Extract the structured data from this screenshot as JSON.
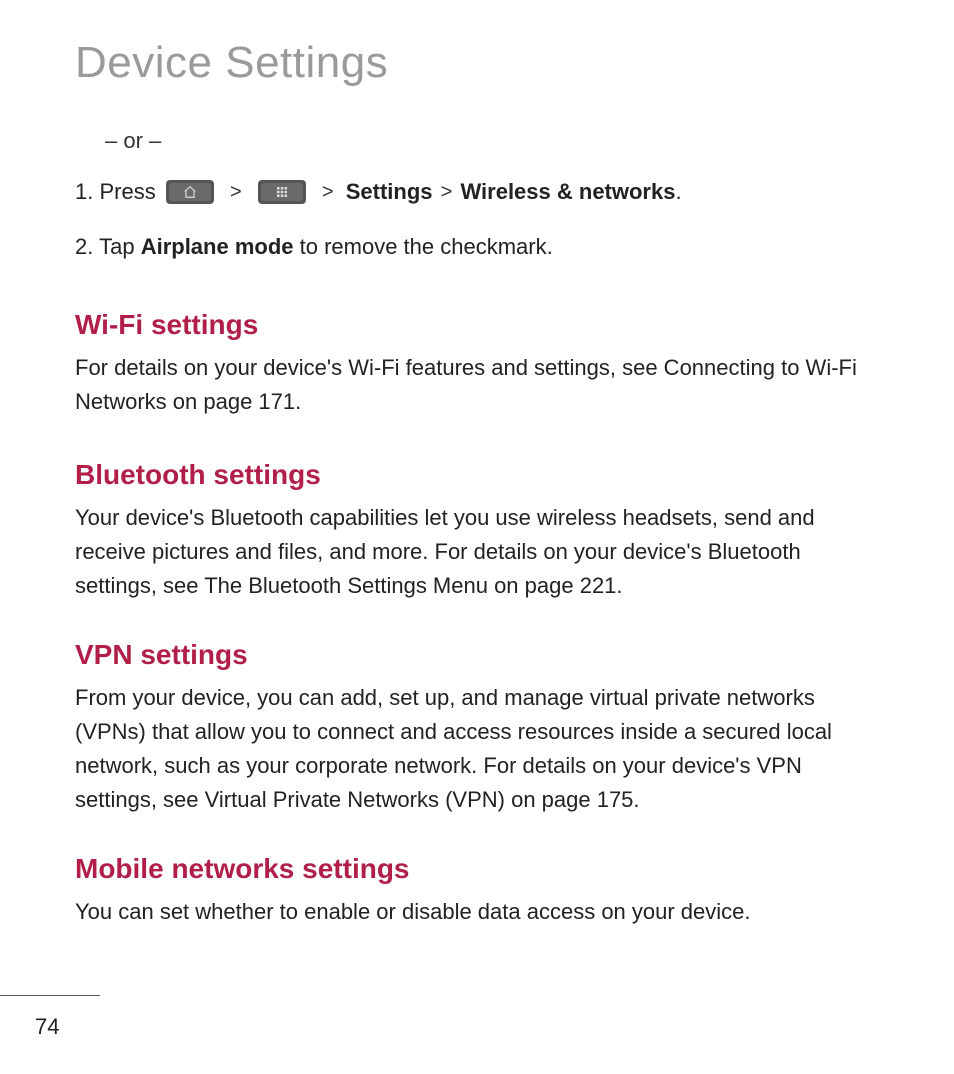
{
  "title": "Device Settings",
  "or_separator": "– or –",
  "step1": {
    "number": "1.",
    "prefix": "Press",
    "chev": ">",
    "settings": "Settings",
    "wireless": "Wireless & networks",
    "period": "."
  },
  "step2": {
    "number": "2.",
    "prefix": "Tap",
    "bold": "Airplane mode",
    "suffix": "to remove the checkmark."
  },
  "sections": {
    "wifi": {
      "head": "Wi-Fi settings",
      "body": "For details on your device's Wi-Fi features and settings, see Connecting to Wi-Fi Networks on page 171."
    },
    "bt": {
      "head": "Bluetooth settings",
      "body": "Your device's Bluetooth capabilities let you use wireless headsets, send and receive pictures and files, and more. For details on your device's Bluetooth settings, see The Bluetooth Settings Menu on page 221."
    },
    "vpn": {
      "head": "VPN settings",
      "body": "From your device, you can add, set up, and manage virtual private networks (VPNs) that allow you to connect and access resources inside a secured local network, such as your corporate network. For details on your device's VPN settings, see Virtual Private Networks (VPN) on page 175."
    },
    "mobile": {
      "head": "Mobile networks settings",
      "body": "You can set whether to enable or disable data access on your device."
    }
  },
  "page_number": "74"
}
